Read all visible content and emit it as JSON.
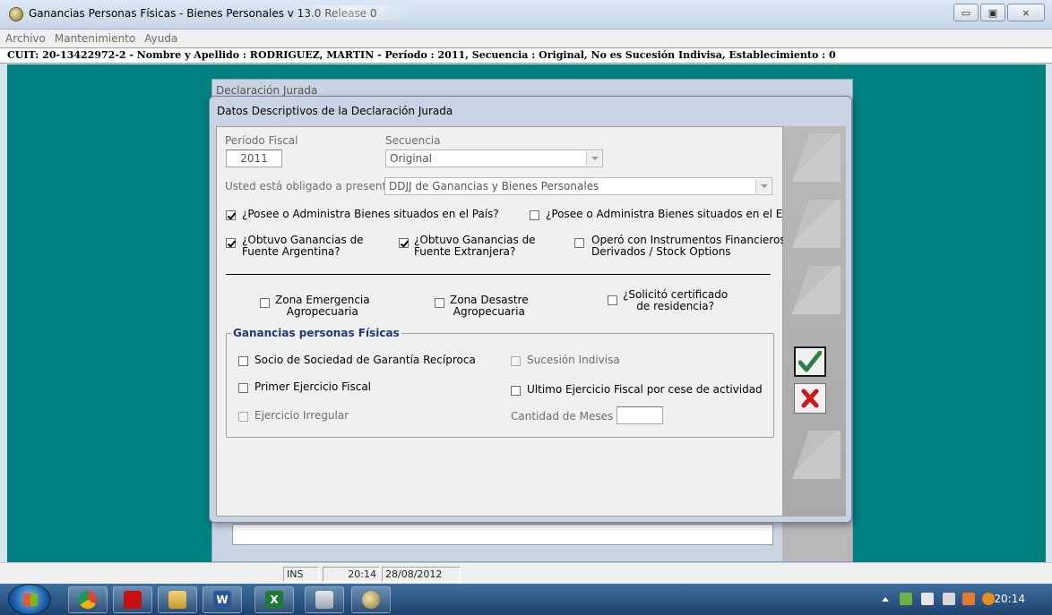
{
  "window": {
    "title": "Ganancias Personas Físicas - Bienes Personales v 13.0 Release 0",
    "controls": {
      "minimize": "▭",
      "maximize": "▣",
      "close": "⨯"
    }
  },
  "menu": [
    "Archivo",
    "Mantenimiento",
    "Ayuda"
  ],
  "info_bar": "CUIT: 20-13422972-2 - Nombre y Apellido : RODRIGUEZ, MARTIN - Período : 2011, Secuencia : Original, No es Sucesión Indivisa, Establecimiento : 0",
  "background_window": {
    "title": "Declaración Jurada"
  },
  "dialog": {
    "title": "Datos Descriptivos de la Declaración Jurada",
    "periodo_label": "Período Fiscal",
    "periodo_value": "2011",
    "secuencia_label": "Secuencia",
    "secuencia_value": "Original",
    "obligado_label": "Usted está obligado a presentar:",
    "obligado_value": "DDJJ de Ganancias y Bienes Personales",
    "chk_bienes_pais": "¿Posee o Administra Bienes situados en el País?",
    "chk_bienes_exterior": "¿Posee o Administra Bienes situados en el Exterior?",
    "chk_gan_arg_1": "¿Obtuvo Ganancias de",
    "chk_gan_arg_2": "Fuente Argentina?",
    "chk_gan_ext_1": "¿Obtuvo Ganancias de",
    "chk_gan_ext_2": "Fuente Extranjera?",
    "chk_instr_1": "Operó con Instrumentos Financieros",
    "chk_instr_2": "Derivados / Stock Options",
    "chk_emerg_1": "Zona Emergencia",
    "chk_emerg_2": "Agropecuaria",
    "chk_desastre_1": "Zona Desastre",
    "chk_desastre_2": "Agropecuaria",
    "chk_cert_1": "¿Solicitó certificado",
    "chk_cert_2": "de residencia?",
    "group_title": "Ganancias personas Físicas",
    "chk_socio": "Socio de Sociedad de Garantía Recíproca",
    "chk_sucesion": "Sucesión Indivisa",
    "chk_primer": "Primer Ejercicio Fiscal",
    "chk_ultimo": "Ultimo Ejercicio Fiscal por cese de actividad",
    "chk_irregular": "Ejercicio Irregular",
    "meses_label": "Cantidad de Meses",
    "meses_value": ""
  },
  "checks": {
    "bienes_pais": true,
    "bienes_exterior": false,
    "gan_arg": true,
    "gan_ext": true,
    "instrumentos": false,
    "emergencia": false,
    "desastre": false,
    "certificado": false,
    "socio": false,
    "sucesion": false,
    "primer": false,
    "ultimo": false,
    "irregular": false
  },
  "status": {
    "mode": "INS",
    "time": "20:14",
    "date": "28/08/2012"
  },
  "taskbar": {
    "apps": [
      "chrome-icon",
      "pdf-icon",
      "explorer-icon",
      "word-icon",
      "excel-icon",
      "afip-icon",
      "ganancias-icon"
    ],
    "word_letter": "W",
    "excel_letter": "X",
    "clock": "20:14"
  },
  "colors": {
    "workspace": "#008080",
    "ok_check": "#2e8b2e",
    "cancel_x": "#d01515",
    "group_title": "#1d3b7a"
  }
}
